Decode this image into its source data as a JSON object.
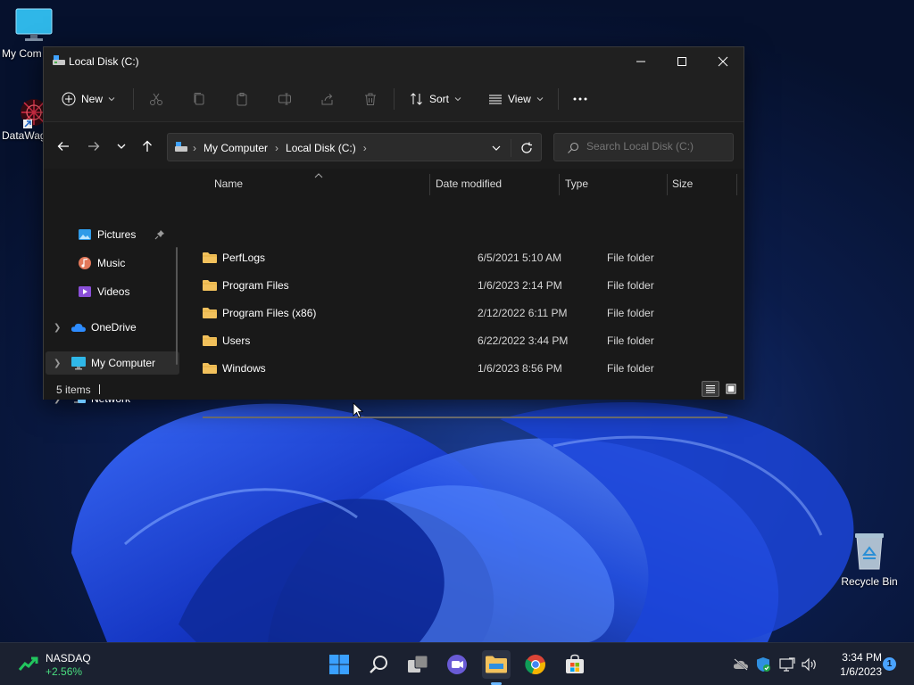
{
  "desktop": {
    "icons": [
      {
        "label": "My Com",
        "icon": "monitor-icon"
      },
      {
        "label": "DataWag",
        "icon": "datawag-shortcut-icon"
      },
      {
        "label": "Recycle Bin",
        "icon": "recycle-bin-icon"
      }
    ]
  },
  "window": {
    "title": "Local Disk (C:)",
    "controls": {
      "minimize": "minimize-icon",
      "maximize": "maximize-icon",
      "close": "close-icon"
    }
  },
  "commands": {
    "new": "New",
    "sort": "Sort",
    "view": "View",
    "disabled_icons": [
      "cut-icon",
      "copy-icon",
      "paste-icon",
      "rename-icon",
      "share-icon",
      "delete-icon"
    ]
  },
  "address": {
    "crumbs": [
      "My Computer",
      "Local Disk (C:)"
    ],
    "search_placeholder": "Search Local Disk (C:)"
  },
  "navpane": {
    "items": [
      {
        "label": "Pictures",
        "icon": "pictures-icon",
        "pinned": true
      },
      {
        "label": "Music",
        "icon": "music-icon"
      },
      {
        "label": "Videos",
        "icon": "videos-icon"
      },
      {
        "label": "OneDrive",
        "icon": "onedrive-icon"
      },
      {
        "label": "My Computer",
        "icon": "computer-icon",
        "selected": true
      },
      {
        "label": "Network",
        "icon": "network-icon"
      }
    ]
  },
  "columns": {
    "name": "Name",
    "date": "Date modified",
    "type": "Type",
    "size": "Size"
  },
  "files": [
    {
      "name": "PerfLogs",
      "date": "6/5/2021 5:10 AM",
      "type": "File folder"
    },
    {
      "name": "Program Files",
      "date": "1/6/2023 2:14 PM",
      "type": "File folder"
    },
    {
      "name": "Program Files (x86)",
      "date": "2/12/2022 6:11 PM",
      "type": "File folder"
    },
    {
      "name": "Users",
      "date": "6/22/2022 3:44 PM",
      "type": "File folder"
    },
    {
      "name": "Windows",
      "date": "1/6/2023 8:56 PM",
      "type": "File folder"
    }
  ],
  "status": {
    "items": "5 items"
  },
  "taskbar": {
    "widget": {
      "name": "NASDAQ",
      "change": "+2.56%"
    },
    "apps": [
      "start-icon",
      "search-icon",
      "task-view-icon",
      "chat-icon",
      "file-explorer-icon",
      "chrome-icon",
      "store-icon"
    ],
    "clock": {
      "time": "3:34 PM",
      "date": "1/6/2023"
    },
    "notifications": "1"
  },
  "colors": {
    "accent": "#0078d4",
    "folder": "#f2c15c",
    "window_bg": "#191919",
    "taskbar_bg": "#1b2130"
  }
}
